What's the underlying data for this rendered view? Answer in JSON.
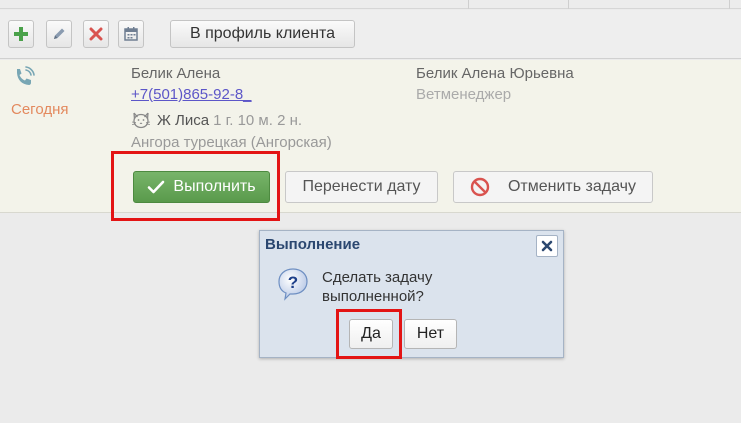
{
  "toolbar": {
    "icons": [
      "plus-icon",
      "pencil-icon",
      "close-icon",
      "calendar-icon"
    ],
    "profile_button_label": "В профиль клиента"
  },
  "task": {
    "type_icon": "phone-icon",
    "date_label": "Сегодня",
    "client_name": "Белик Алена",
    "client_phone": "+7(501)865-92-8_",
    "pet_icon": "cat-icon",
    "pet_name": "Ж Лиса",
    "pet_age": "1 г. 10 м. 2 н.",
    "pet_breed": "Ангора турецкая (Ангорская)",
    "assignee_name": "Белик Алена Юрьевна",
    "assignee_role": "Ветменеджер",
    "buttons": {
      "complete_label": "Выполнить",
      "reschedule_label": "Перенести дату",
      "cancel_label": "Отменить задачу"
    }
  },
  "dialog": {
    "title": "Выполнение",
    "message": "Сделать задачу выполненной?",
    "yes_label": "Да",
    "no_label": "Нет"
  },
  "colors": {
    "accent_green": "#67a55a",
    "highlight_red": "#e31414",
    "date_orange": "#e3895e",
    "link_blue": "#5c56c8",
    "dialog_title": "#2b4770"
  }
}
